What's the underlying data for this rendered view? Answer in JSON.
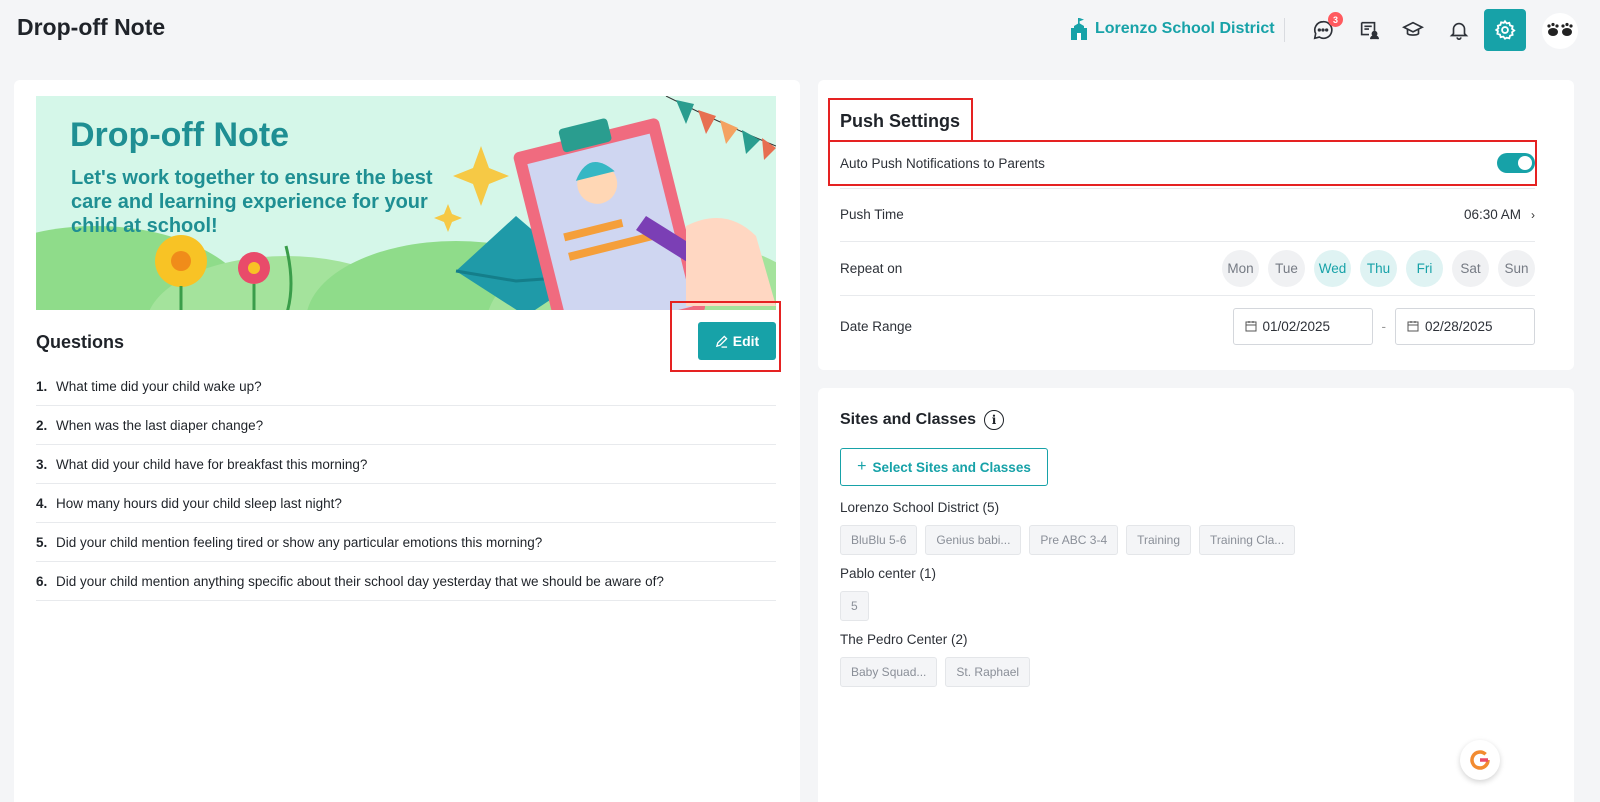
{
  "header": {
    "title": "Drop-off Note",
    "district": "Lorenzo School District",
    "messages_badge": "3"
  },
  "banner": {
    "title": "Drop-off Note",
    "subtitle": "Let's work together to ensure the best care and learning experience for your child at school!"
  },
  "questions": {
    "title": "Questions",
    "edit_label": "Edit",
    "items": [
      {
        "num": "1.",
        "text": "What time did your child wake up?"
      },
      {
        "num": "2.",
        "text": "When was the last diaper change?"
      },
      {
        "num": "3.",
        "text": "What did your child have for breakfast this morning?"
      },
      {
        "num": "4.",
        "text": "How many hours did your child sleep last night?"
      },
      {
        "num": "5.",
        "text": "Did your child mention feeling tired or show any particular emotions this morning?"
      },
      {
        "num": "6.",
        "text": "Did your child mention anything specific about their school day yesterday that we should be aware of?"
      }
    ]
  },
  "push_settings": {
    "title": "Push Settings",
    "auto_push_label": "Auto Push Notifications to Parents",
    "auto_push_enabled": true,
    "push_time_label": "Push Time",
    "push_time_value": "06:30 AM",
    "repeat_label": "Repeat on",
    "days": [
      {
        "label": "Mon",
        "on": false
      },
      {
        "label": "Tue",
        "on": false
      },
      {
        "label": "Wed",
        "on": true
      },
      {
        "label": "Thu",
        "on": true
      },
      {
        "label": "Fri",
        "on": true
      },
      {
        "label": "Sat",
        "on": false
      },
      {
        "label": "Sun",
        "on": false
      }
    ],
    "date_range_label": "Date Range",
    "date_start": "01/02/2025",
    "date_end": "02/28/2025",
    "date_separator": "-"
  },
  "sites": {
    "title": "Sites and Classes",
    "select_label": "Select Sites and Classes",
    "groups": [
      {
        "name": "Lorenzo School District (5)",
        "classes": [
          "BluBlu 5-6",
          "Genius babi...",
          "Pre ABC 3-4",
          "Training",
          "Training Cla..."
        ]
      },
      {
        "name": "Pablo center (1)",
        "classes": [
          "5"
        ]
      },
      {
        "name": "The Pedro Center (2)",
        "classes": [
          "Baby Squad...",
          "St. Raphael"
        ]
      }
    ]
  },
  "colors": {
    "accent": "#17a2a8",
    "highlight": "#e52222"
  }
}
